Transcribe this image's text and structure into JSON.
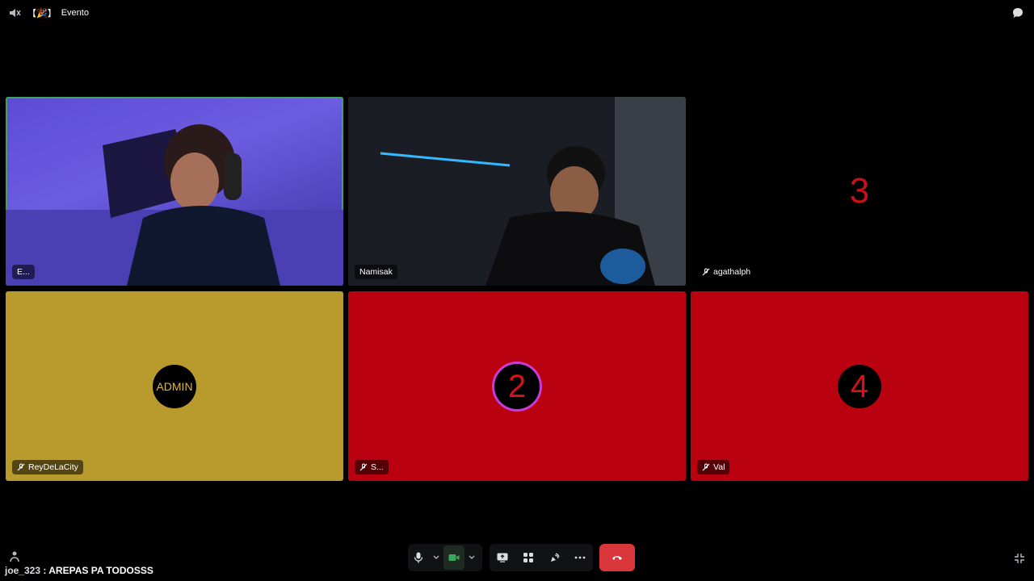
{
  "header": {
    "channel_prefix": "【🎉】",
    "channel_name": "Evento"
  },
  "tiles": [
    {
      "name": "E...",
      "muted": false,
      "speaking": true
    },
    {
      "name": "Namisak",
      "muted": false,
      "speaking": true
    },
    {
      "name": "agathalph",
      "muted": true,
      "avatar_text": "3",
      "speaking": false
    },
    {
      "name": "ReyDeLaCity",
      "muted": true,
      "avatar_text": "ADMIN",
      "speaking": false
    },
    {
      "name": "S...",
      "muted": true,
      "avatar_text": "2",
      "speaking": false
    },
    {
      "name": "Val",
      "muted": true,
      "avatar_text": "4",
      "speaking": false
    }
  ],
  "colors": {
    "gold": "#b89a2d",
    "red": "#ba010f",
    "speaking_green": "#3ba55d",
    "hangup": "#da373c"
  },
  "chat": {
    "user": "joe_323",
    "separator": " : ",
    "message": "AREPAS PA TODOSSS"
  },
  "icons": {
    "speaker": "speaker-icon",
    "chat": "chat-bubble-icon",
    "mic": "microphone-icon",
    "camera": "camera-icon",
    "screen": "screen-share-icon",
    "activities": "activities-icon",
    "soundboard": "soundboard-icon",
    "more": "more-icon",
    "hangup": "hang-up-icon",
    "fullscreen": "exit-fullscreen-icon"
  }
}
